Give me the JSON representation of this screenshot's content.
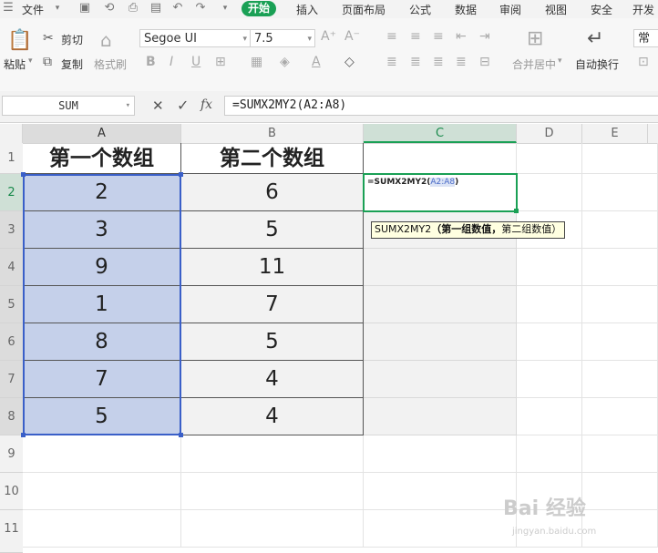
{
  "menubar": {
    "file": "文件",
    "tabs": [
      "开始",
      "插入",
      "页面布局",
      "公式",
      "数据",
      "审阅",
      "视图",
      "安全",
      "开发"
    ],
    "active_tab": "开始"
  },
  "ribbon": {
    "paste": "粘贴",
    "cut": "剪切",
    "copy": "复制",
    "format_painter": "格式刷",
    "font_name": "Segoe UI",
    "font_size": "7.5",
    "merge_center": "合并居中",
    "wrap_text": "自动换行",
    "number_format": "常规",
    "font_increase": "A⁺",
    "font_decrease": "A⁻",
    "bold": "B",
    "italic": "I",
    "underline": "U",
    "font_color": "A"
  },
  "formula_bar": {
    "name_box": "SUM",
    "formula": "=SUMX2MY2(A2:A8)",
    "fx": "fx",
    "cancel": "✕",
    "confirm": "✓"
  },
  "grid": {
    "columns": [
      "A",
      "B",
      "C",
      "D",
      "E"
    ],
    "rows": [
      "1",
      "2",
      "3",
      "4",
      "5",
      "6",
      "7",
      "8",
      "9",
      "10",
      "11"
    ],
    "header_a": "第一个数组",
    "header_b": "第二个数组",
    "col_a_values": [
      "2",
      "3",
      "9",
      "1",
      "8",
      "7",
      "5"
    ],
    "col_b_values": [
      "6",
      "5",
      "11",
      "7",
      "5",
      "4",
      "4"
    ],
    "active_cell_formula_prefix": "=SUMX2MY2(",
    "active_cell_formula_ref": "A2:A8",
    "active_cell_formula_suffix": ")",
    "tooltip_fn": "SUMX2MY2",
    "tooltip_arg1": "（第一组数值，",
    "tooltip_arg2": "第二组数值）"
  },
  "watermark": {
    "brand": "Bai 经验",
    "url": "jingyan.baidu.com"
  },
  "colors": {
    "accent_green": "#1aa055",
    "selection_blue": "#c5d0ea",
    "selection_border": "#3a5fc8"
  }
}
